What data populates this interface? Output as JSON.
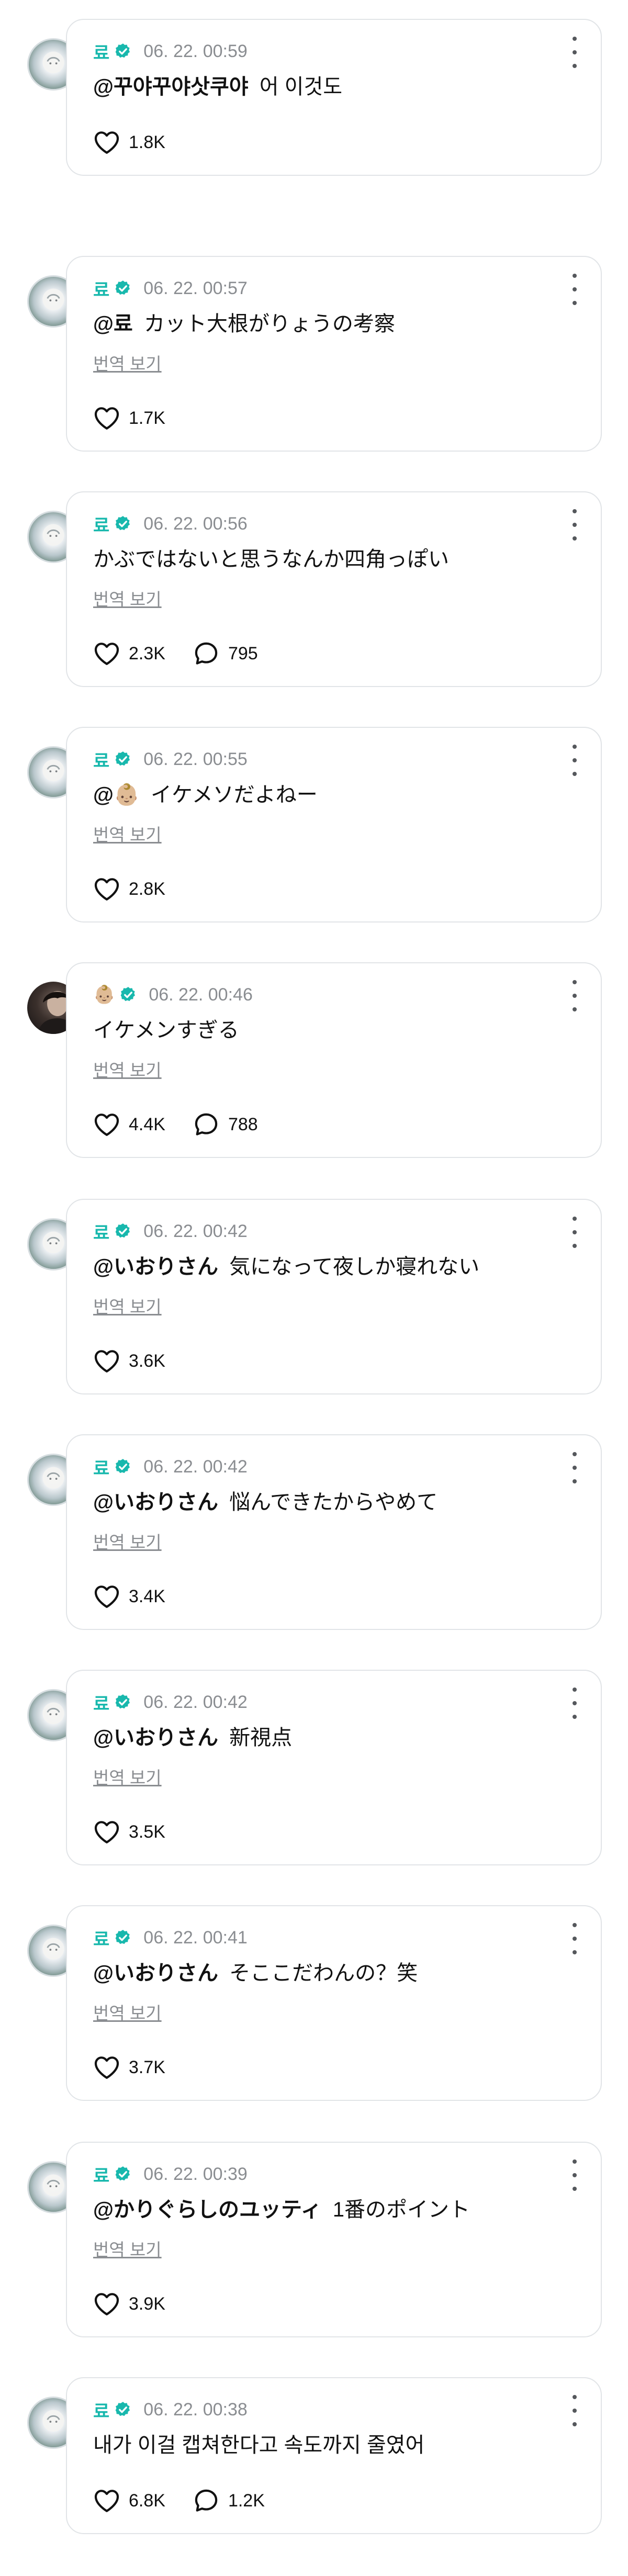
{
  "translate_label": "번역 보기",
  "posts": [
    {
      "author": "료",
      "author_type": "text",
      "avatar": "light",
      "verified": true,
      "time": "06. 22. 00:59",
      "mention": "@꾸야꾸야삿쿠야",
      "text": "어 이것도",
      "show_translate": false,
      "likes": "1.8K",
      "comments": null
    },
    {
      "author": "료",
      "author_type": "text",
      "avatar": "light",
      "verified": true,
      "time": "06. 22. 00:57",
      "mention": "@료",
      "text": "カット大根がりょうの考察",
      "show_translate": true,
      "likes": "1.7K",
      "comments": null
    },
    {
      "author": "료",
      "author_type": "text",
      "avatar": "light",
      "verified": true,
      "time": "06. 22. 00:56",
      "mention": "",
      "text": "かぶではないと思うなんか四角っぽい",
      "show_translate": true,
      "likes": "2.3K",
      "comments": "795"
    },
    {
      "author": "료",
      "author_type": "text",
      "avatar": "light",
      "verified": true,
      "time": "06. 22. 00:55",
      "mention": "@👶🏼",
      "text": "イケメソだよねー",
      "show_translate": true,
      "likes": "2.8K",
      "comments": null
    },
    {
      "author": "👶🏼",
      "author_type": "emoji",
      "avatar": "dark",
      "verified": true,
      "time": "06. 22. 00:46",
      "mention": "",
      "text": "イケメンすぎる",
      "show_translate": true,
      "likes": "4.4K",
      "comments": "788"
    },
    {
      "author": "료",
      "author_type": "text",
      "avatar": "light",
      "verified": true,
      "time": "06. 22. 00:42",
      "mention": "@いおりさん",
      "text": "気になって夜しか寝れない",
      "show_translate": true,
      "likes": "3.6K",
      "comments": null
    },
    {
      "author": "료",
      "author_type": "text",
      "avatar": "light",
      "verified": true,
      "time": "06. 22. 00:42",
      "mention": "@いおりさん",
      "text": "悩んできたからやめて",
      "show_translate": true,
      "likes": "3.4K",
      "comments": null
    },
    {
      "author": "료",
      "author_type": "text",
      "avatar": "light",
      "verified": true,
      "time": "06. 22. 00:42",
      "mention": "@いおりさん",
      "text": "新視点",
      "show_translate": true,
      "likes": "3.5K",
      "comments": null
    },
    {
      "author": "료",
      "author_type": "text",
      "avatar": "light",
      "verified": true,
      "time": "06. 22. 00:41",
      "mention": "@いおりさん",
      "text": "そここだわんの？笑",
      "show_translate": true,
      "likes": "3.7K",
      "comments": null
    },
    {
      "author": "료",
      "author_type": "text",
      "avatar": "light",
      "verified": true,
      "time": "06. 22. 00:39",
      "mention": "@かりぐらしのユッティ",
      "text": "1番のポイント",
      "show_translate": true,
      "likes": "3.9K",
      "comments": null
    },
    {
      "author": "료",
      "author_type": "text",
      "avatar": "light",
      "verified": true,
      "time": "06. 22. 00:38",
      "mention": "",
      "text": "내가 이걸 캡쳐한다고 속도까지 줄였어",
      "show_translate": false,
      "likes": "6.8K",
      "comments": "1.2K"
    }
  ],
  "colors": {
    "accent": "#18b8ad",
    "muted": "#8a8d91",
    "border": "#e1e4e7"
  },
  "icons": {
    "like": "heart-outline-icon",
    "comment": "speech-bubble-icon",
    "more": "vertical-dots-icon",
    "verified": "verified-badge-icon"
  }
}
